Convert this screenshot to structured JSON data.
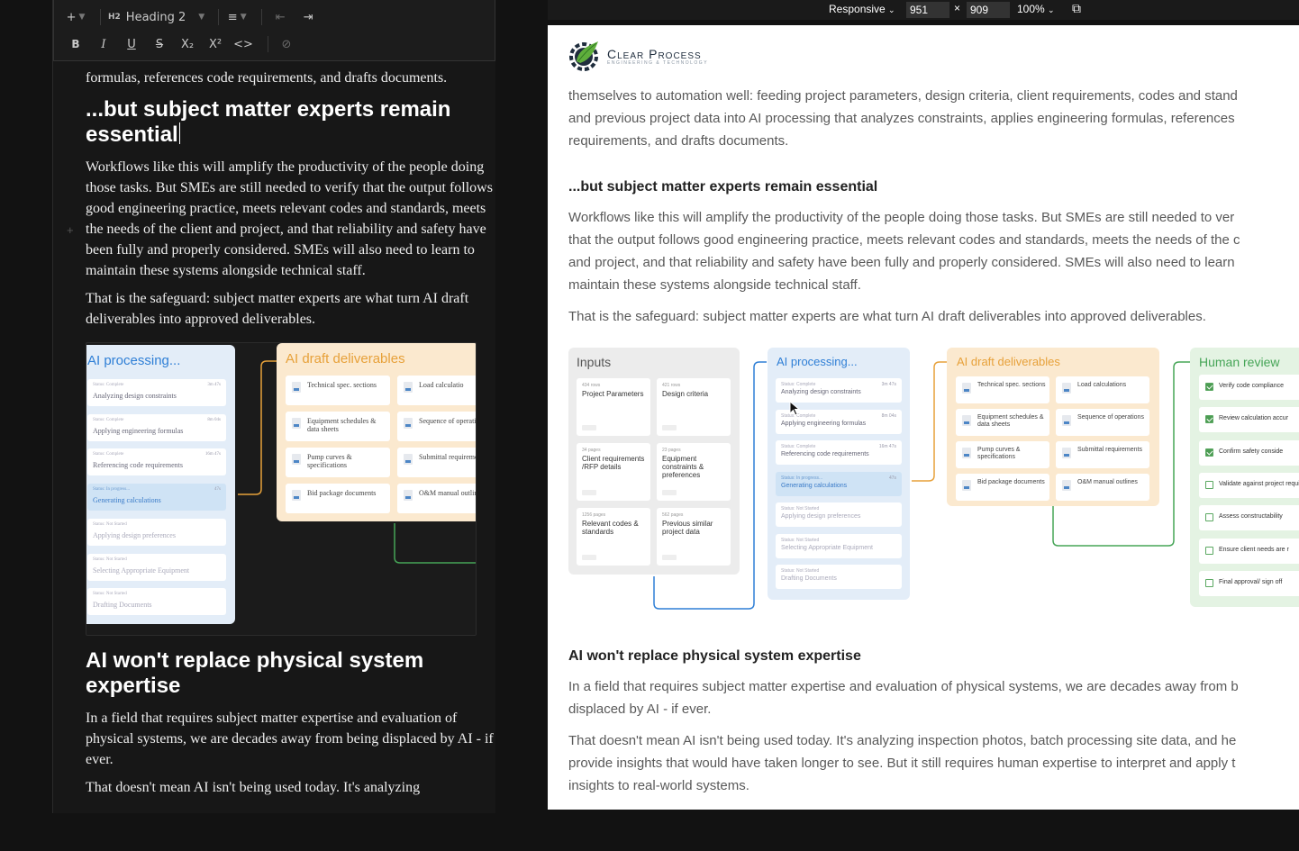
{
  "editor": {
    "toolbar": {
      "add": "+",
      "heading_tag": "H2",
      "heading_label": "Heading 2",
      "bold": "B",
      "italic": "I",
      "underline": "U",
      "strike": "S",
      "subscript": "X₂",
      "superscript": "X²",
      "code": "<>"
    },
    "top_fragment": "formulas, references code requirements, and drafts documents.",
    "heading1": "...but subject matter experts remain essential",
    "para1": "Workflows like this will amplify the productivity of the people doing those tasks. But SMEs are still needed to verify that the output follows good engineering practice, meets relevant codes and standards, meets the needs of the client and project, and that reliability and safety have been fully and properly considered. SMEs will also need to learn to maintain these systems alongside technical staff.",
    "para2": "That is the safeguard: subject matter experts are what turn AI draft deliverables into approved deliverables.",
    "heading2": "AI won't replace physical system expertise",
    "para3": "In a field that requires subject matter expertise and evaluation of physical systems, we are decades away from being displaced by AI - if ever.",
    "para4": "That doesn't mean AI isn't being used today. It's analyzing"
  },
  "preview_bar": {
    "mode": "Responsive",
    "width": "951",
    "times": "×",
    "height": "909",
    "zoom": "100%"
  },
  "preview": {
    "logo_name": "Clear Process",
    "logo_sub": "ENGINEERING & TECHNOLOGY",
    "top_line1": "themselves to automation well: feeding project parameters, design criteria, client requirements, codes and stand",
    "top_line2": "and previous project data into AI processing that analyzes constraints, applies engineering formulas, references",
    "top_line3": "requirements, and drafts documents.",
    "heading1": "...but subject matter experts remain essential",
    "para1_l1": "Workflows like this will amplify the productivity of the people doing those tasks. But SMEs are still needed to ver",
    "para1_l2": "that the output follows good engineering practice, meets relevant codes and standards, meets the needs of the c",
    "para1_l3": "and project, and that reliability and safety have been fully and properly considered. SMEs will also need to learn",
    "para1_l4": "maintain these systems alongside technical staff.",
    "para2": "That is the safeguard: subject matter experts are what turn AI draft deliverables into approved deliverables.",
    "heading2": "AI won't replace physical system expertise",
    "para3_l1": "In a field that requires subject matter expertise and evaluation of physical systems, we are decades away from b",
    "para3_l2": "displaced by AI - if ever.",
    "para4_l1": "That doesn't mean AI isn't being used today. It's analyzing inspection photos, batch processing site data, and he",
    "para4_l2": "provide insights that would have taken longer to see. But it still requires human expertise to interpret and apply t",
    "para4_l3": "insights to real-world systems."
  },
  "diagram": {
    "inputs_title": "Inputs",
    "inputs": [
      {
        "size": "434 rows",
        "label": "Project Parameters"
      },
      {
        "size": "421 rows",
        "label": "Design criteria"
      },
      {
        "size": "34 pages",
        "label": "Client requirements /RFP details"
      },
      {
        "size": "23 pages",
        "label": "Equipment constraints & preferences"
      },
      {
        "size": "1256 pages",
        "label": "Relevant codes & standards"
      },
      {
        "size": "562 pages",
        "label": "Previous similar project data"
      }
    ],
    "processing_title": "AI processing...",
    "steps": [
      {
        "status": "Status: Complete",
        "name": "Analyzing design constraints",
        "time": "3m 47s"
      },
      {
        "status": "Status: Complete",
        "name": "Applying engineering formulas",
        "time": "8m 04s"
      },
      {
        "status": "Status: Complete",
        "name": "Referencing code requirements",
        "time": "16m 47s"
      },
      {
        "status": "Status: In progress...",
        "name": "Generating calculations",
        "time": "47s"
      },
      {
        "status": "Status: Not Started",
        "name": "Applying design preferences",
        "time": ""
      },
      {
        "status": "Status: Not Started",
        "name": "Selecting Appropriate Equipment",
        "time": ""
      },
      {
        "status": "Status: Not Started",
        "name": "Drafting Documents",
        "time": ""
      }
    ],
    "deliverables_title": "AI draft deliverables",
    "deliverables": [
      "Technical spec. sections",
      "Load calculations",
      "Equipment schedules & data sheets",
      "Sequence of operations",
      "Pump curves & specifications",
      "Submittal requirements",
      "Bid package documents",
      "O&M manual outlines"
    ],
    "left_deliverables": [
      "Technical spec. sections",
      "Load calculatio",
      "Equipment schedules & data sheets",
      "Sequence of operations",
      "Pump curves & specifications",
      "Submittal requirements",
      "Bid package documents",
      "O&M manual outlines"
    ],
    "review_title": "Human review",
    "review": [
      {
        "label": "Verify code compliance",
        "done": true
      },
      {
        "label": "Review calculation accur",
        "done": true
      },
      {
        "label": "Confirm safety conside",
        "done": true
      },
      {
        "label": "Validate against project requirements",
        "done": false
      },
      {
        "label": "Assess constructability",
        "done": false
      },
      {
        "label": "Ensure client needs are r",
        "done": false
      },
      {
        "label": "Final approval/ sign off",
        "done": false
      }
    ],
    "colors": {
      "blue": "#2f7fd6",
      "orange": "#e7a13a",
      "green": "#46a557",
      "blue_panel": "#e3edf8",
      "orange_panel": "#fbe9cf",
      "green_panel": "#e4f3e3"
    }
  }
}
